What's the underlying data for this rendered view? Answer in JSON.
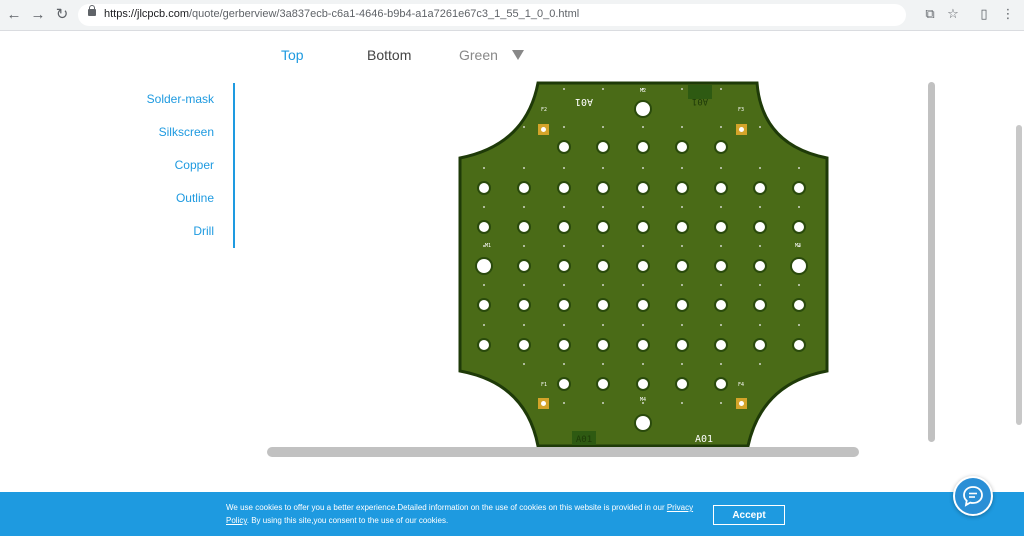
{
  "browser": {
    "back_icon": "arrow-left-icon",
    "forward_icon": "arrow-right-icon",
    "reload_icon": "reload-icon",
    "url_host": "https://jlcpcb.com",
    "url_path": "/quote/gerberview/3a837ecb-c6a1-4646-b9b4-a1a7261e67c3_1_55_1_0_0.html"
  },
  "view_tabs": {
    "top": "Top",
    "bottom": "Bottom",
    "color": "Green"
  },
  "layers": [
    "Solder-mask",
    "Silkscreen",
    "Copper",
    "Outline",
    "Drill"
  ],
  "board": {
    "label_top": "A01",
    "label_top_box": "A01",
    "label_bottom_box": "A01",
    "label_bottom": "A01",
    "hole_labels": {
      "m1": "M1",
      "m2": "M2",
      "m3": "M3",
      "m4": "M4",
      "f1": "F1",
      "f2": "F2",
      "f3": "F3",
      "f4": "F4"
    },
    "colors": {
      "mask": "#4a6b17",
      "edge": "#1e3a08",
      "pad": "#d4a42a"
    }
  },
  "cookie": {
    "text_before": "We use cookies to offer you a better experience.Detailed information on the use of cookies on this website is provided in our ",
    "link": "Privacy Policy",
    "text_after": ". By using this site,you consent to the use of our cookies.",
    "accept": "Accept"
  },
  "colors": {
    "accent": "#1e9ae0"
  }
}
